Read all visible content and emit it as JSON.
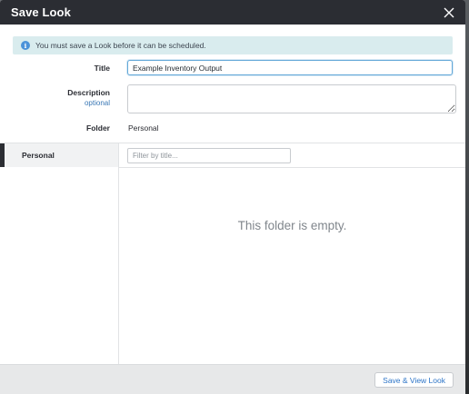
{
  "dialog": {
    "title": "Save Look"
  },
  "notice": {
    "text": "You must save a Look before it can be scheduled."
  },
  "form": {
    "title_label": "Title",
    "title_value": "Example Inventory Output",
    "description_label": "Description",
    "description_sublabel": "optional",
    "description_value": "",
    "folder_label": "Folder",
    "folder_value": "Personal"
  },
  "folder_browser": {
    "nav_items": [
      {
        "label": "Personal",
        "selected": true
      }
    ],
    "filter_placeholder": "Filter by title...",
    "empty_message": "This folder is empty."
  },
  "footer": {
    "save_label": "Save & View Look"
  },
  "colors": {
    "header_bg": "#2b2d33",
    "notice_bg": "#d9ecee",
    "info_icon": "#4b93d9",
    "link_blue": "#2c74c7",
    "footer_bg": "#e7e8e9"
  },
  "icons": {
    "close": "close-icon",
    "info": "info-icon"
  }
}
